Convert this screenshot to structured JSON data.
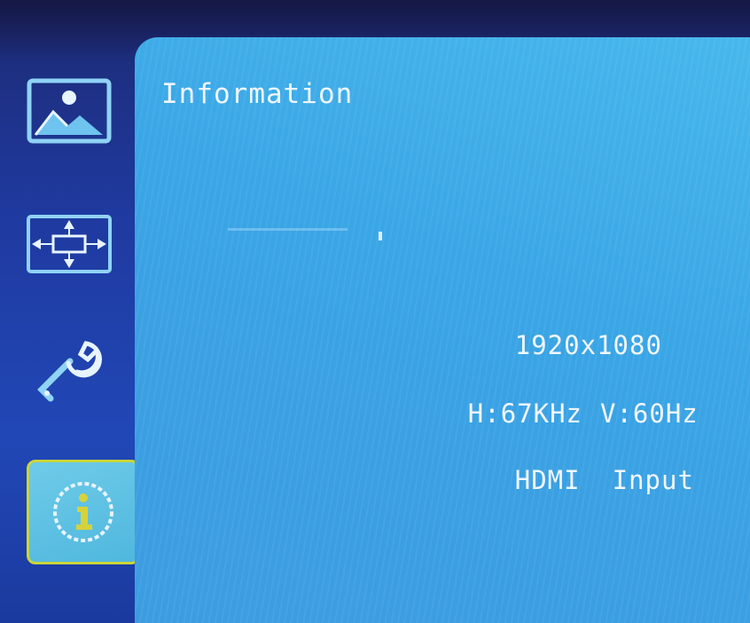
{
  "panel": {
    "title": "Information"
  },
  "sidebar": {
    "items": [
      {
        "icon": "picture-icon",
        "selected": false
      },
      {
        "icon": "image-position-icon",
        "selected": false
      },
      {
        "icon": "wrench-settings-icon",
        "selected": false
      },
      {
        "icon": "info-icon",
        "selected": true
      }
    ]
  },
  "info": {
    "resolution": "1920x1080",
    "h_label": "H:",
    "h_value": "67KHz",
    "v_label": "V:",
    "v_value": "60Hz",
    "input_source": "HDMI",
    "input_label": "Input"
  },
  "colors": {
    "sidebar_bg": "#1f3aa0",
    "panel_bg": "#3aa6e6",
    "text": "#f2f7ff",
    "icon_line": "#8fd3f5",
    "selected_border": "#c9d63a",
    "info_accent": "#d6d23a"
  }
}
